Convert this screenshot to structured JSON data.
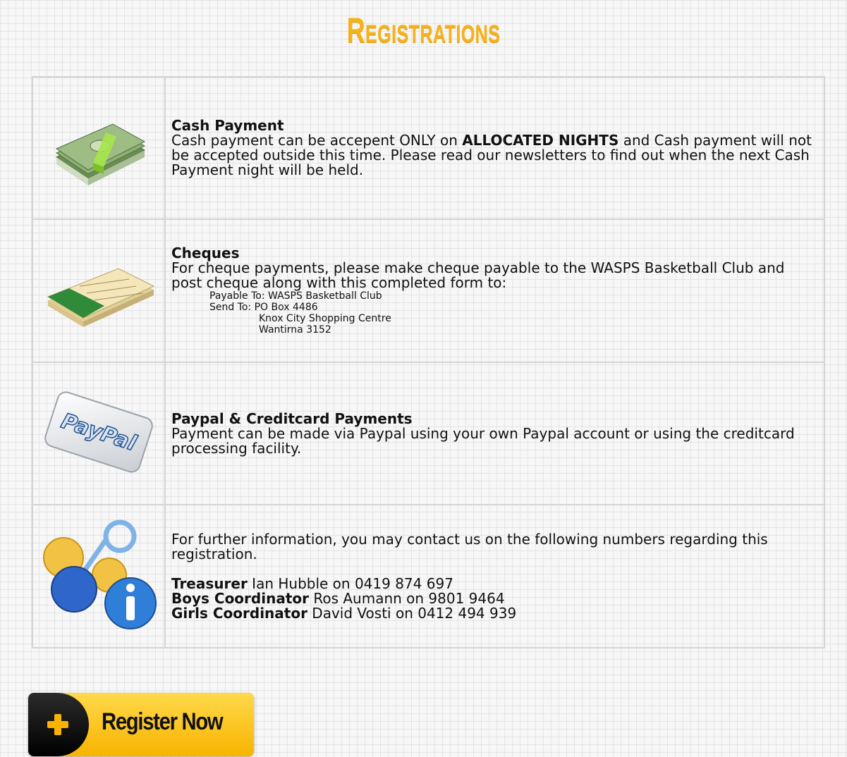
{
  "page": {
    "title": "Registrations"
  },
  "payments": {
    "cash": {
      "heading": "Cash Payment",
      "text_before": "Cash payment can be accepent ONLY on ",
      "text_bold": "ALLOCATED NIGHTS",
      "text_after": " and Cash payment will not be accepted outside this time. Please read our newsletters to find out when the next Cash Payment night will be held.",
      "icon": "cash-icon"
    },
    "cheques": {
      "heading": "Cheques",
      "text": "For cheque payments, please make cheque payable to the WASPS Basketball Club and post cheque along with this completed form to:",
      "payable_to": "Payable To:  WASPS Basketball Club",
      "send_to": "Send To:     PO Box 4486",
      "address_line2": "Knox City Shopping Centre",
      "address_line3": "Wantirna 3152",
      "icon": "cheque-book-icon"
    },
    "paypal": {
      "heading": "Paypal & Creditcard Payments",
      "text": "Payment can be made via Paypal using your own Paypal account or using the creditcard processing facility.",
      "card_text": "PayPal",
      "icon": "paypal-card-icon"
    },
    "contact": {
      "intro": "For further information, you may contact us on the following numbers regarding this registration.",
      "contacts": [
        {
          "role": "Treasurer",
          "detail": " Ian Hubble on 0419 874 697"
        },
        {
          "role": "Boys Coordinator",
          "detail": " Ros Aumann on 9801 9464"
        },
        {
          "role": "Girls Coordinator",
          "detail": " David Vosti on 0412 494 939"
        }
      ],
      "icon": "info-icon"
    }
  },
  "register_button": {
    "label": "Register Now",
    "icon": "plus-icon"
  },
  "colors": {
    "accent": "#f5b21c",
    "button": "#ffc90e",
    "border": "#d4d4d4"
  }
}
